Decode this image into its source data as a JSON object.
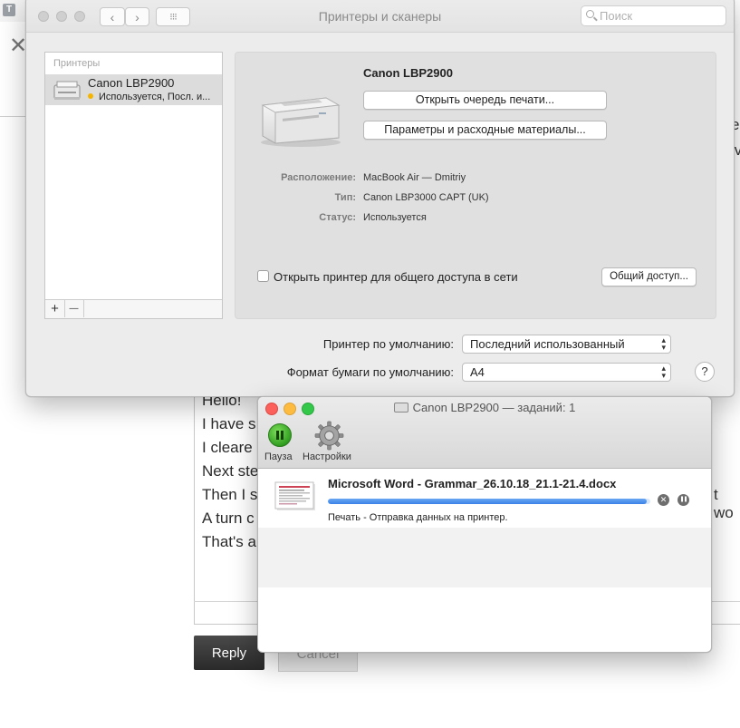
{
  "background": {
    "tab_letter": "T",
    "close_glyph": "✕",
    "right_snippets": [
      "e",
      "iv",
      "t wo"
    ],
    "editor_lines": [
      "Hello!",
      "I have s",
      "I cleare",
      "Next ste",
      "Then I s",
      "A turn c",
      "That's a"
    ],
    "reply_label": "Reply",
    "cancel_label": "Cancel"
  },
  "main_window": {
    "title": "Принтеры и сканеры",
    "search_placeholder": "Поиск",
    "nav_back": "‹",
    "nav_forward": "›",
    "grid_icon": "⁝⁝⁝",
    "printer_list": {
      "header": "Принтеры",
      "items": [
        {
          "name": "Canon LBP2900",
          "status": "Используется, Посл. и..."
        }
      ],
      "add_label": "+",
      "remove_label": "—"
    },
    "detail": {
      "printer_name": "Canon LBP2900",
      "open_queue_button": "Открыть очередь печати...",
      "options_button": "Параметры и расходные материалы...",
      "fields": [
        {
          "label": "Расположение:",
          "value": "MacBook Air — Dmitriy"
        },
        {
          "label": "Тип:",
          "value": "Canon LBP3000 CAPT (UK)"
        },
        {
          "label": "Статус:",
          "value": "Используется"
        }
      ],
      "share_checkbox_label": "Открыть принтер для общего доступа в сети",
      "share_checked": false,
      "sharing_button": "Общий доступ..."
    },
    "default_printer_label": "Принтер по умолчанию:",
    "default_printer_value": "Последний использованный",
    "default_paper_label": "Формат бумаги по умолчанию:",
    "default_paper_value": "A4",
    "help_label": "?"
  },
  "queue_window": {
    "title": "Canon LBP2900 — заданий: 1",
    "pause_label": "Пауза",
    "settings_label": "Настройки",
    "job": {
      "title": "Microsoft Word - Grammar_26.10.18_21.1-21.4.docx",
      "progress": 0.99,
      "status": "Печать - Отправка данных на принтер.",
      "delete_glyph": "✕",
      "hold_glyph": "❚❚"
    }
  },
  "colors": {
    "traffic_close": "#fc605b",
    "traffic_min": "#fdbc40",
    "traffic_max": "#34c84a",
    "status_dot": "#f5b400",
    "progress": "#3b82e8"
  }
}
